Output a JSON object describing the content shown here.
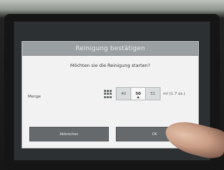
{
  "dialog": {
    "title": "Reinigung bestätigen",
    "question": "Möchten sie die Reinigung starten?",
    "amount_label": "Menge",
    "stepper": {
      "options": [
        "40",
        "50",
        "51"
      ],
      "selected_value": "50"
    },
    "unit": "ml (1.7 oz.)",
    "cancel_label": "Abbrechen",
    "ok_label": "OK"
  },
  "colors": {
    "titlebar": "#9a9fa1",
    "button": "#65696c",
    "dialog_bg": "#f1f2f1"
  },
  "icons": [
    "keypad-icon",
    "caret-up-icon"
  ]
}
